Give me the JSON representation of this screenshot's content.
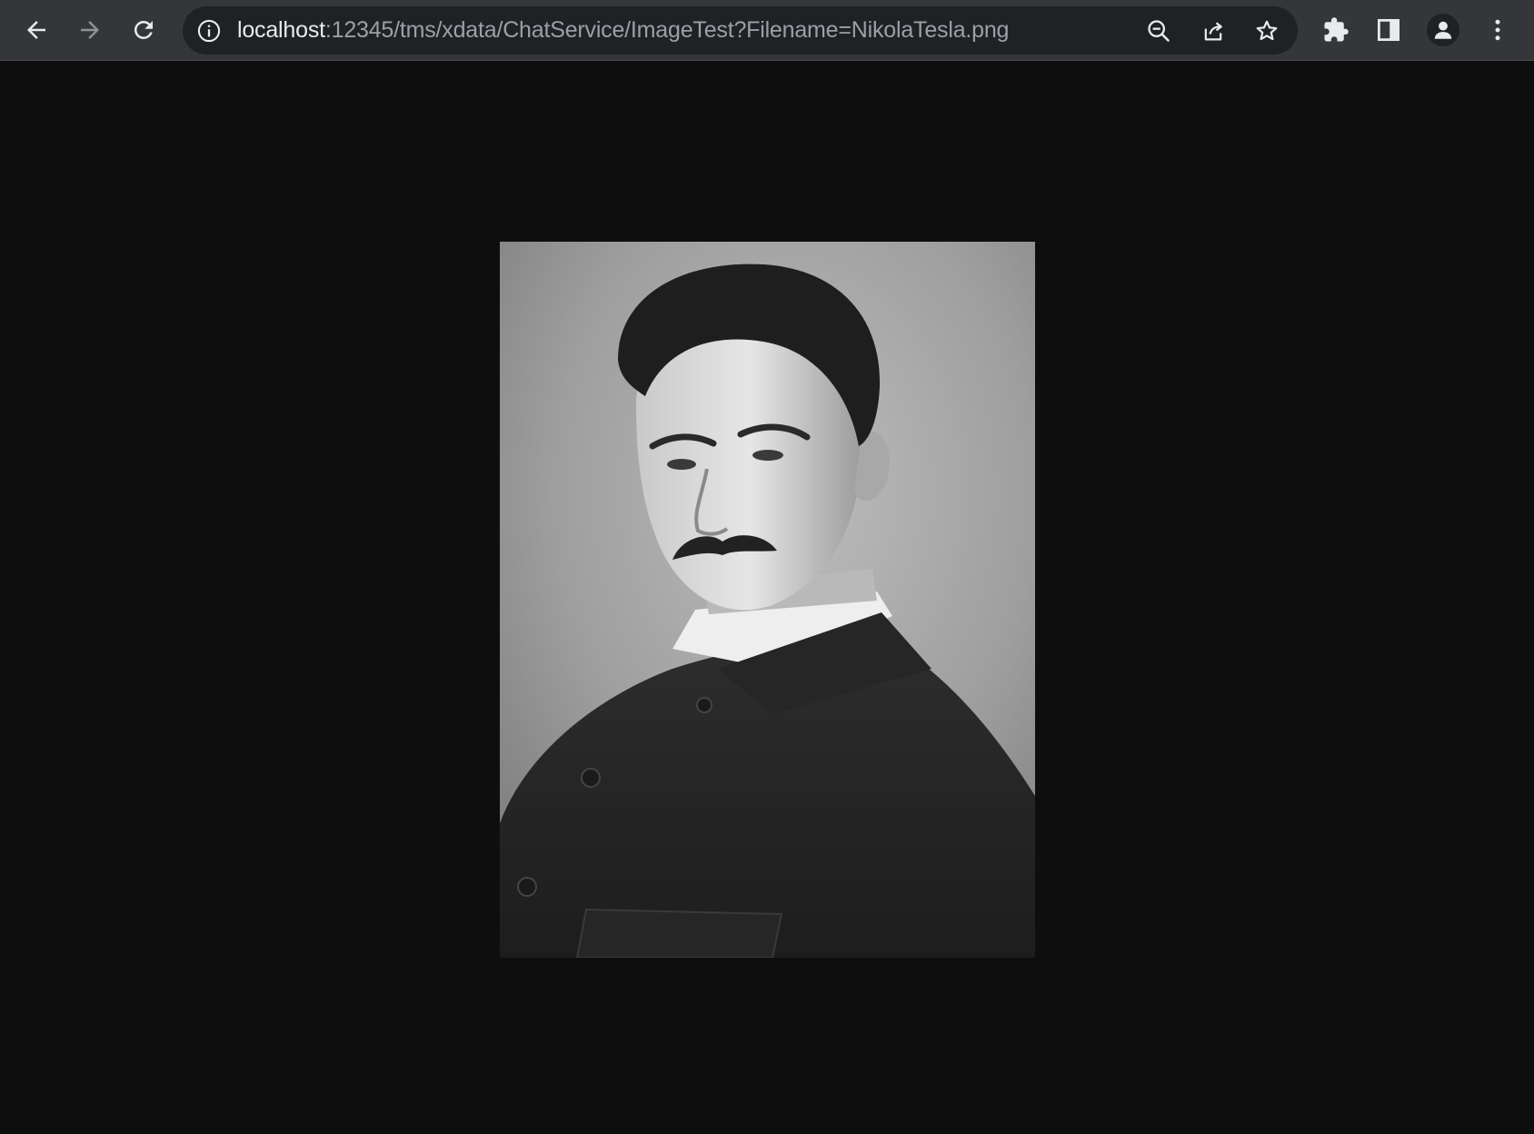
{
  "browser": {
    "url_host": "localhost",
    "url_path": ":12345/tms/xdata/ChatService/ImageTest?Filename=NikolaTesla.png",
    "icons": {
      "back": "arrow-left-icon",
      "forward": "arrow-right-icon",
      "reload": "reload-icon",
      "site_info": "info-icon",
      "zoom": "zoom-out-icon",
      "share": "share-icon",
      "bookmark": "star-icon",
      "extensions": "puzzle-icon",
      "side_panel": "side-panel-icon",
      "profile": "profile-icon",
      "menu": "kebab-menu-icon"
    }
  },
  "page": {
    "background": "#0e0e0f",
    "image": {
      "kind": "black-and-white portrait photograph"
    }
  }
}
